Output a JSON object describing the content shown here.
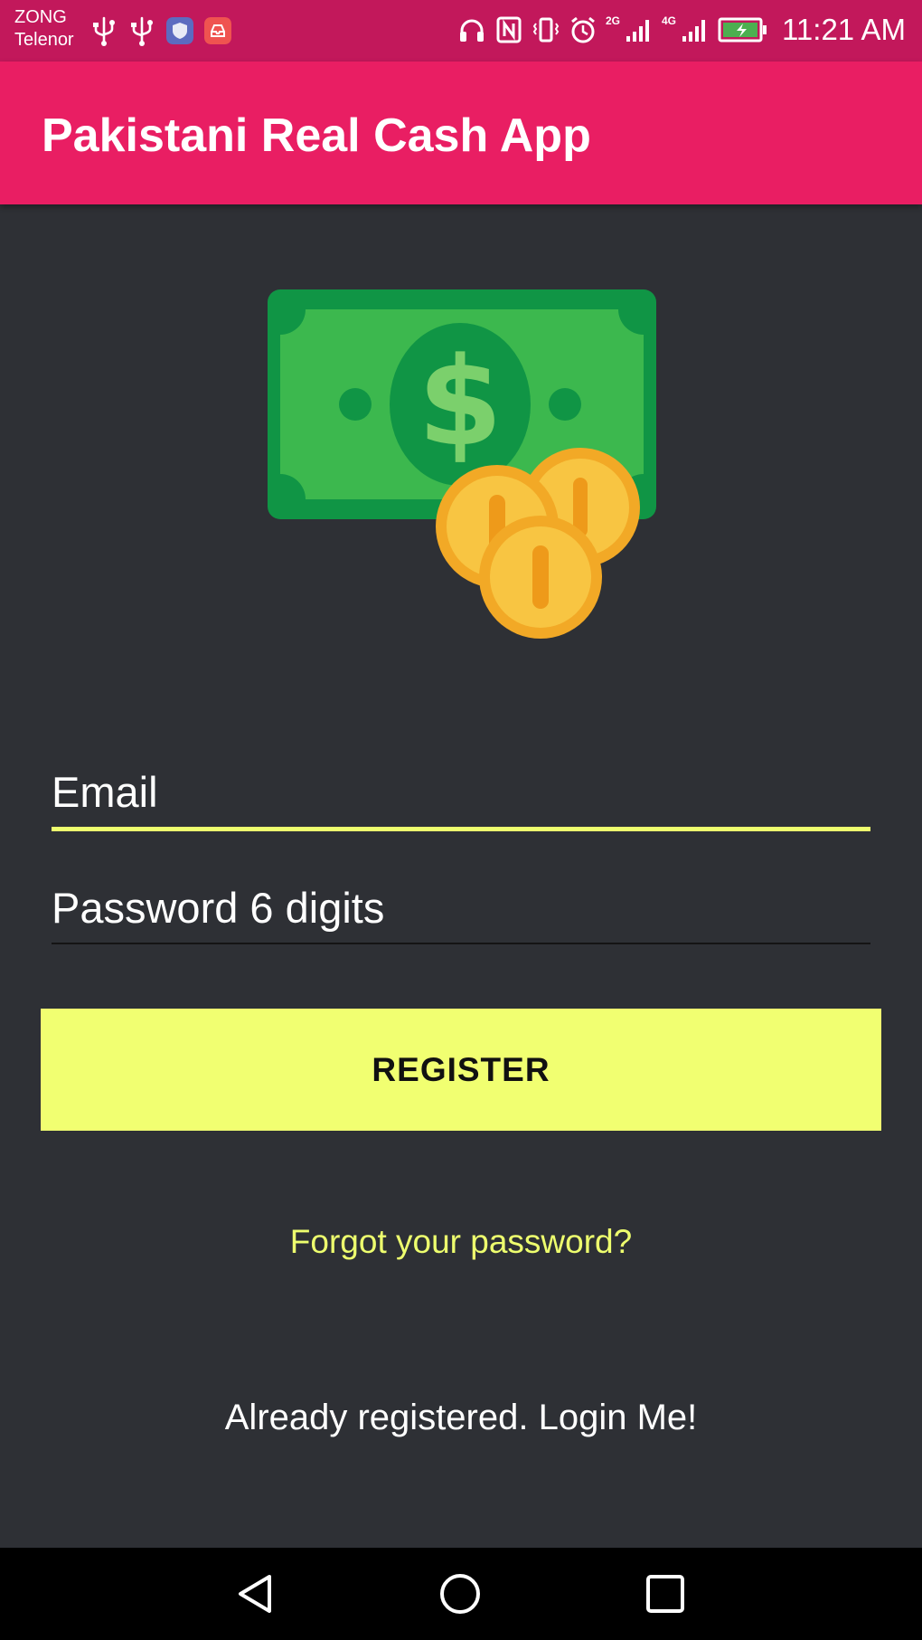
{
  "status_bar": {
    "carrier_1": "ZONG",
    "carrier_2": "Telenor",
    "network_1": "2G",
    "network_2": "4G",
    "time": "11:21 AM",
    "icons": [
      "usb-icon",
      "usb-icon",
      "shield-app-icon",
      "inbox-app-icon",
      "headphones-icon",
      "nfc-icon",
      "vibrate-icon",
      "alarm-icon",
      "signal-icon",
      "signal-icon",
      "battery-charging-icon"
    ]
  },
  "app_bar": {
    "title": "Pakistani Real Cash App",
    "color": "#e91e63"
  },
  "hero": {
    "icon": "cash-and-coins-icon"
  },
  "form": {
    "email_placeholder": "Email",
    "password_placeholder": "Password 6 digits",
    "accent_color": "#eeff6e"
  },
  "register_button": {
    "label": "REGISTER",
    "color": "#f1ff71"
  },
  "links": {
    "forgot_password": "Forgot your password?",
    "login": "Already registered. Login Me!"
  },
  "navigation": {
    "back_icon": "back-triangle-icon",
    "home_icon": "home-circle-icon",
    "recent_icon": "recent-square-icon"
  },
  "colors": {
    "background": "#2e3035",
    "status_bar": "#c2185b"
  }
}
